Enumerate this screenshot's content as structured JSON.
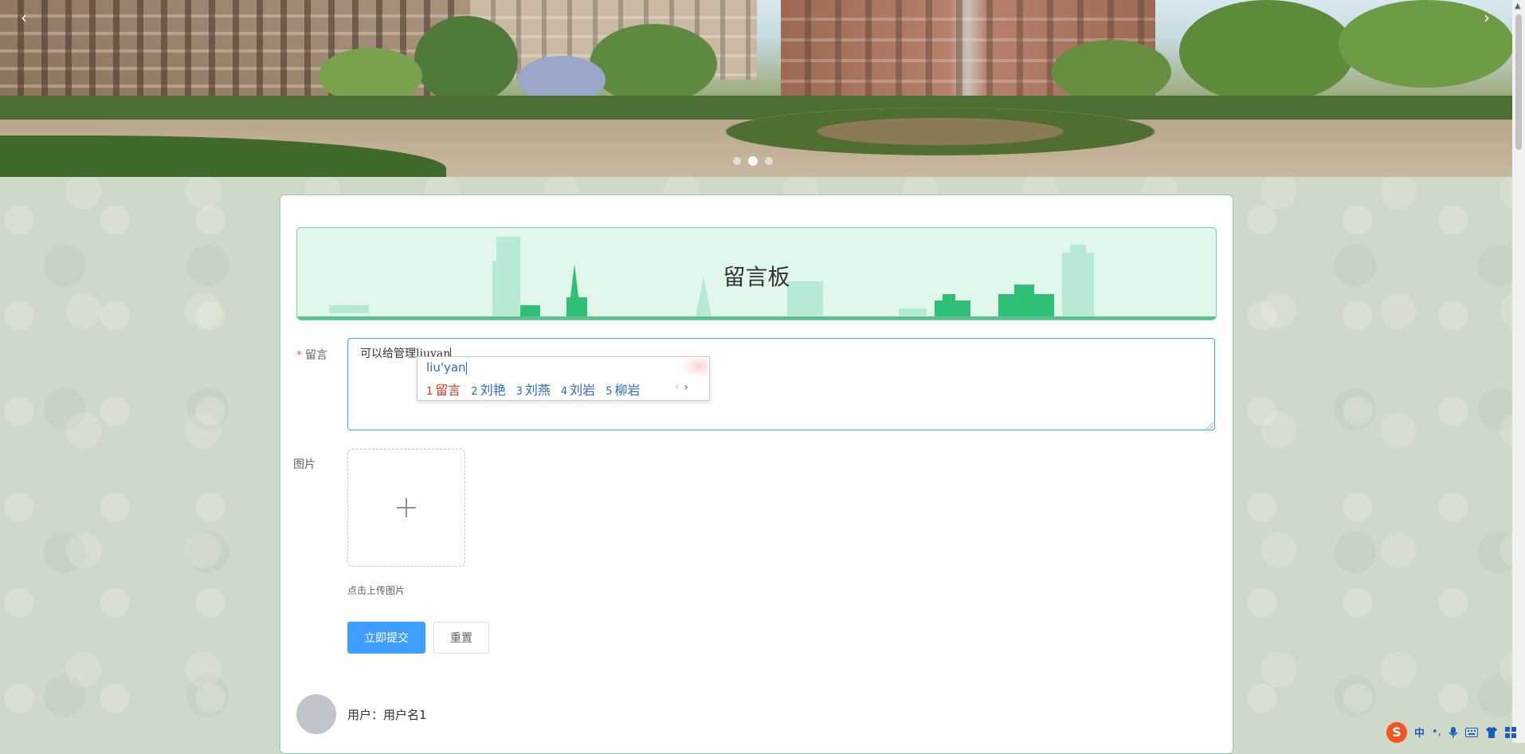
{
  "banner": {
    "prev_arrow": "‹",
    "next_arrow": "›",
    "dots_count": 3,
    "active_dot": 2
  },
  "board": {
    "title": "留言板"
  },
  "form": {
    "message_label": "留言",
    "required_mark": "*",
    "message_value": "可以给管理liuyan",
    "image_label": "图片",
    "upload_tip": "点击上传图片",
    "submit_label": "立即提交",
    "reset_label": "重置"
  },
  "ime": {
    "pinyin": "liu'yan",
    "candidates": [
      {
        "num": "1",
        "text": "留言"
      },
      {
        "num": "2",
        "text": "刘艳"
      },
      {
        "num": "3",
        "text": "刘燕"
      },
      {
        "num": "4",
        "text": "刘岩"
      },
      {
        "num": "5",
        "text": "柳岩"
      }
    ],
    "prev": "‹",
    "next": "›"
  },
  "comments": [
    {
      "user_line": "用户：用户名1"
    }
  ],
  "tray": {
    "logo": "S",
    "mode": "中",
    "punct": "•,",
    "icons": [
      "microphone-icon",
      "keyboard-icon",
      "shirt-icon",
      "grid-icon"
    ]
  },
  "colors": {
    "primary": "#409eff",
    "accent_green": "#57c28a",
    "required": "#f56c6c",
    "ime_blue": "#2b6cc4",
    "ime_red": "#e0342c"
  }
}
